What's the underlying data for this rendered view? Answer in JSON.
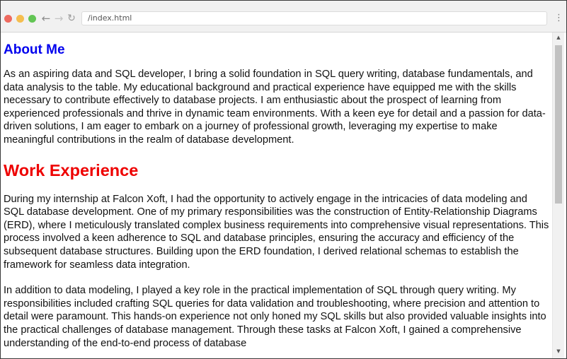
{
  "browser": {
    "address": "/index.html",
    "nav": {
      "back_icon": "←",
      "forward_icon": "→",
      "reload_icon": "↻",
      "menu_icon": "⋮"
    }
  },
  "page": {
    "about_heading": "About Me",
    "about_text": "As an aspiring data and SQL developer, I bring a solid foundation in SQL query writing, database fundamentals, and data analysis to the table. My educational background and practical experience have equipped me with the skills necessary to contribute effectively to database projects. I am enthusiastic about the prospect of learning from experienced professionals and thrive in dynamic team environments. With a keen eye for detail and a passion for data-driven solutions, I am eager to embark on a journey of professional growth, leveraging my expertise to make meaningful contributions in the realm of database development.",
    "work_heading": "Work Experience",
    "work_paragraphs": [
      "During my internship at Falcon Xoft, I had the opportunity to actively engage in the intricacies of data modeling and SQL database development. One of my primary responsibilities was the construction of Entity-Relationship Diagrams (ERD), where I meticulously translated complex business requirements into comprehensive visual representations. This process involved a keen adherence to SQL and database principles, ensuring the accuracy and efficiency of the subsequent database structures. Building upon the ERD foundation, I derived relational schemas to establish the framework for seamless data integration.",
      "In addition to data modeling, I played a key role in the practical implementation of SQL through query writing. My responsibilities included crafting SQL queries for data validation and troubleshooting, where precision and attention to detail were paramount. This hands-on experience not only honed my SQL skills but also provided valuable insights into the practical challenges of database management. Through these tasks at Falcon Xoft, I gained a comprehensive understanding of the end-to-end process of database"
    ]
  },
  "colors": {
    "about_heading": "#0000ee",
    "work_heading": "#ee0000",
    "traffic_red": "#ee6a5f",
    "traffic_yellow": "#f5be4f",
    "traffic_green": "#62c554"
  }
}
